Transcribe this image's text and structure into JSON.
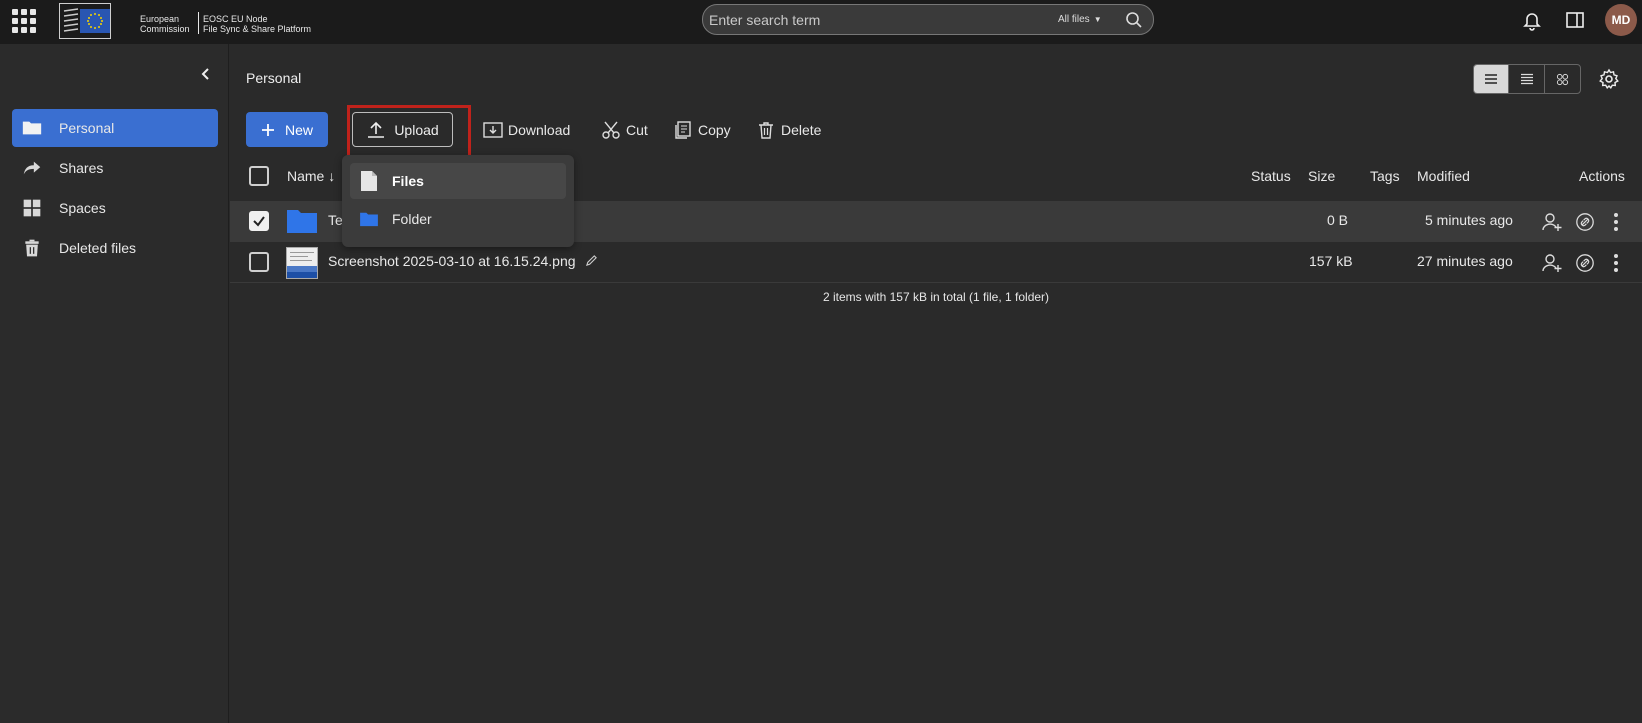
{
  "topbar": {
    "logo_line1": "European",
    "logo_line2": "Commission",
    "logo_sub1": "EOSC EU Node",
    "logo_sub2": "File Sync & Share Platform",
    "search_placeholder": "Enter search term",
    "search_scope": "All files",
    "avatar_initials": "MD"
  },
  "sidebar": {
    "items": [
      {
        "label": "Personal",
        "icon": "folder-icon"
      },
      {
        "label": "Shares",
        "icon": "share-arrow-icon"
      },
      {
        "label": "Spaces",
        "icon": "grid-icon"
      },
      {
        "label": "Deleted files",
        "icon": "trash-icon"
      }
    ]
  },
  "main": {
    "breadcrumb": "Personal",
    "toolbar": {
      "new_label": "New",
      "upload_label": "Upload",
      "download_label": "Download",
      "cut_label": "Cut",
      "copy_label": "Copy",
      "delete_label": "Delete"
    },
    "upload_menu": {
      "files_label": "Files",
      "folder_label": "Folder"
    },
    "columns": {
      "name": "Name",
      "status": "Status",
      "size": "Size",
      "tags": "Tags",
      "modified": "Modified",
      "actions": "Actions"
    },
    "rows": [
      {
        "name": "Te",
        "size": "0 B",
        "modified": "5 minutes ago",
        "selected": true
      },
      {
        "name": "Screenshot 2025-03-10 at 16.15.24.png",
        "size": "157 kB",
        "modified": "27 minutes ago",
        "selected": false
      }
    ],
    "summary": "2 items with 157 kB in total (1 file, 1 folder)"
  },
  "colors": {
    "accent": "#3a6fd1",
    "highlight_box": "#c0221b",
    "background": "#2a2a2a",
    "topbar": "#1b1b1b"
  }
}
